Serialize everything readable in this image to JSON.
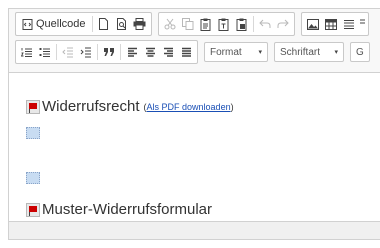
{
  "toolbar": {
    "source_label": "Quellcode",
    "format_label": "Format",
    "font_label": "Schriftart",
    "next_combo_label": "G"
  },
  "content": {
    "line1_title": "Widerrufsrecht",
    "line1_link_open": "(",
    "line1_link": "Als PDF downloaden",
    "line1_link_close": ")",
    "line2_title": "Muster-Widerrufsformular"
  },
  "colors": {
    "flag": "#cc0000",
    "link": "#1a4fb5",
    "anchor": "#c8dcf2"
  }
}
